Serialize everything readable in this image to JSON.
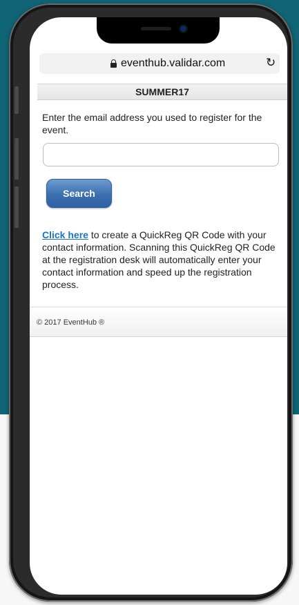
{
  "browser": {
    "url": "eventhub.validar.com",
    "lock_icon": "lock-icon",
    "reload_icon": "reload-icon"
  },
  "event": {
    "code": "SUMMER17"
  },
  "form": {
    "prompt": "Enter the email address you used to register for the event.",
    "email_value": "",
    "search_label": "Search"
  },
  "info": {
    "link_text": "Click here",
    "text": " to create a QuickReg QR Code with your contact information. Scanning this QuickReg QR Code at the registration desk will automatically enter your contact information and speed up the registration process."
  },
  "footer": {
    "copyright": "© 2017 EventHub ®"
  },
  "colors": {
    "background_top": "#0f6475",
    "link": "#1a73c6",
    "button": "#3b6fb0"
  }
}
